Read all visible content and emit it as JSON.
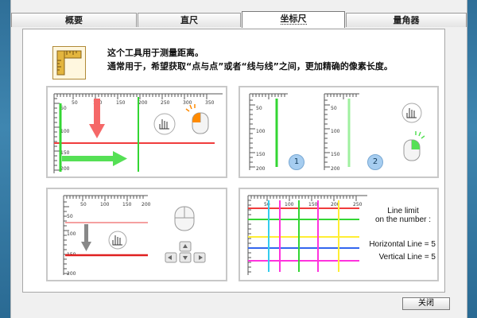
{
  "tabs": [
    {
      "label": "概要",
      "active": false
    },
    {
      "label": "直尺",
      "active": false
    },
    {
      "label": "坐标尺",
      "active": true
    },
    {
      "label": "量角器",
      "active": false
    }
  ],
  "description": {
    "line1": "这个工具用于测量距离。",
    "line2": "通常用于，希望获取“点与点”或者“线与线”之间，更加精确的像素长度。"
  },
  "panel1": {
    "ticks": [
      "50",
      "100",
      "150",
      "200",
      "250",
      "300",
      "350"
    ],
    "yticks": [
      "50",
      "100",
      "150",
      "200"
    ]
  },
  "panel2": {
    "ticks": [
      "50",
      "100",
      "150",
      "200"
    ],
    "step1": "1",
    "step2": "2"
  },
  "panel3": {
    "ticks": [
      "50",
      "100",
      "150",
      "200"
    ],
    "yticks": [
      "50",
      "100",
      "150",
      "200"
    ]
  },
  "panel4": {
    "ticks": [
      "50",
      "100",
      "150",
      "200",
      "250"
    ],
    "limit_line1": "Line limit",
    "limit_line2": "on the number :",
    "horizontal": "Horizontal Line = 5",
    "vertical": "Vertical Line = 5"
  },
  "close_label": "关闭",
  "colors": {
    "red": "#f03c3c",
    "green": "#33d633",
    "light_green": "#9ff09f",
    "yellow": "#ffee33",
    "magenta": "#ff33dd",
    "cyan": "#33ccee",
    "blue": "#3366ee"
  }
}
